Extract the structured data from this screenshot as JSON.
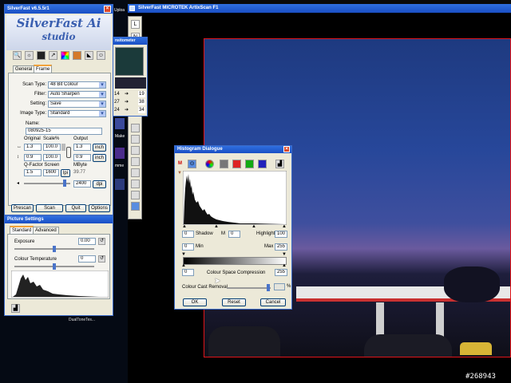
{
  "desktop": {
    "top_text": "Uploa",
    "label_mixname": "Make",
    "label_mine": "mme",
    "label_dual": "DualToneTes...",
    "watermark": "#268943"
  },
  "main_window": {
    "title": "SilverFast MICROTEK ArtixScan F1"
  },
  "silverfast_window": {
    "title": "SilverFast v6.5.5r1",
    "logo_line1": "SilverFast Ai",
    "logo_line2": "studio",
    "tabs": [
      "General",
      "Frame"
    ],
    "scan_type_label": "Scan Type:",
    "scan_type_value": "48 Bit Colour",
    "filter_label": "Filter:",
    "filter_value": "Auto Sharpen",
    "setting_label": "Setting:",
    "setting_value": "Save",
    "image_type_label": "Image Type:",
    "image_type_value": "Standard",
    "name_label": "Name:",
    "name_value": "080925-15",
    "original_label": "Original",
    "scale_label": "Scale%",
    "output_label": "Output",
    "width_orig": "1.3",
    "scale_w": "100.0",
    "width_out": "1.3",
    "height_orig": "0.9",
    "scale_h": "100.0",
    "height_out": "0.9",
    "unit": "inch",
    "qfactor_label": "Q-Factor Screen",
    "mbyte_label": "MByte",
    "qfactor_value": "1.5",
    "screen_value": "1600",
    "screen_unit": "lpi",
    "mbyte_value": "39.77",
    "dpi_value": "2400",
    "dpi_unit": "dpi",
    "prescan": "Prescan",
    "scan": "Scan",
    "quit": "Quit",
    "options": "Options"
  },
  "picture_settings": {
    "title": "Picture Settings",
    "tabs": [
      "Standard",
      "Advanced"
    ],
    "exposure_label": "Exposure",
    "exposure_value": "0.00",
    "colour_temp_label": "Colour Temperature",
    "colour_temp_value": "0"
  },
  "densitometer": {
    "title": "nsitometer",
    "rows": [
      {
        "left": "14",
        "right": "19"
      },
      {
        "left": "27",
        "right": "38"
      },
      {
        "left": "24",
        "right": "34"
      }
    ]
  },
  "toolstrip": {
    "buttons": [
      "L",
      "N"
    ]
  },
  "histogram_dialog": {
    "title": "Histogram Dialogue",
    "shadow_value": "0",
    "shadow_label": "Shadow",
    "mid_symbol": "M",
    "mid_value": "0",
    "highlight_label": "Highlight",
    "highlight_value": "100",
    "min_value": "0",
    "min_label": "Min",
    "max_label": "Max",
    "max_value": "255",
    "ccs_left": "0",
    "ccs_label": "Colour Space Compression",
    "ccs_right": "255",
    "cast_label": "Colour Cast Removal",
    "cast_unit": "%",
    "ok": "OK",
    "reset": "Reset",
    "cancel": "Cancel"
  }
}
